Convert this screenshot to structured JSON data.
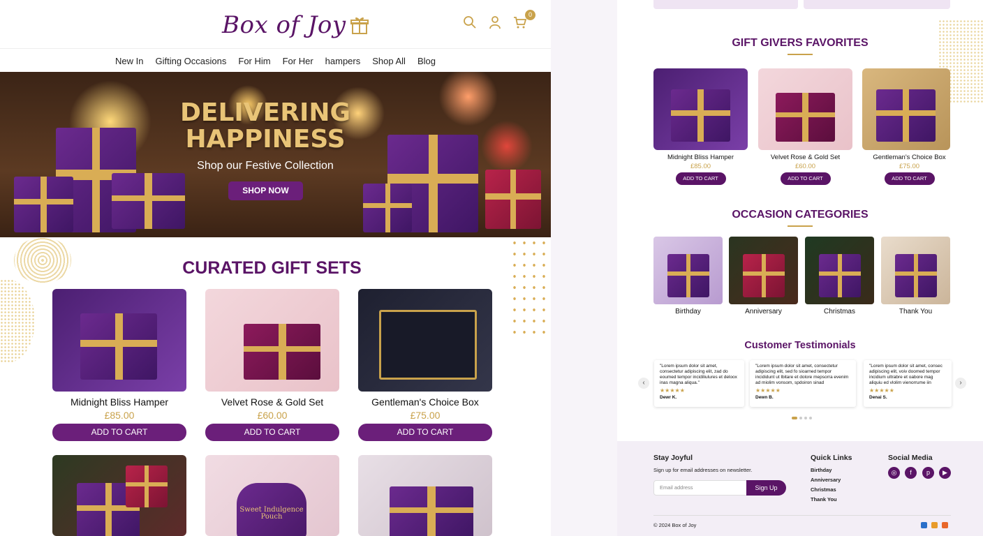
{
  "brand": {
    "logo_text": "Box of Joy",
    "primary": "#5a1466",
    "accent": "#c9a24b"
  },
  "header": {
    "icons": [
      "search-icon",
      "user-icon",
      "cart-icon"
    ],
    "cart_count": "0"
  },
  "nav": [
    "New In",
    "Gifting Occasions",
    "For Him",
    "For Her",
    "hampers",
    "Shop All",
    "Blog"
  ],
  "hero": {
    "title_line1": "DELIVERING",
    "title_line2": "HAPPINESS",
    "subtitle": "Shop our Festive Collection",
    "cta": "SHOP NOW"
  },
  "curated": {
    "title": "CURATED GIFT SETS",
    "items": [
      {
        "name": "Midnight Bliss Hamper",
        "price": "£85.00",
        "cta": "ADD TO CART"
      },
      {
        "name": "Velvet Rose & Gold Set",
        "price": "£60.00",
        "cta": "ADD TO CART"
      },
      {
        "name": "Gentleman's Choice Box",
        "price": "£75.00",
        "cta": "ADD TO CART"
      }
    ],
    "row2_pouch_text": "Sweet Indulgence Pouch"
  },
  "favorites": {
    "title": "GIFT GIVERS FAVORITES",
    "items": [
      {
        "name": "Midnight Bliss Hamper",
        "price": "£85.00",
        "cta": "ADD TO CART"
      },
      {
        "name": "Velvet Rose & Gold Set",
        "price": "£60.00",
        "cta": "ADD TO CART"
      },
      {
        "name": "Gentleman's Choice Box",
        "price": "£75.00",
        "cta": "ADD TO CART"
      }
    ]
  },
  "occasions": {
    "title": "OCCASION CATEGORIES",
    "items": [
      "Birthday",
      "Anniversary",
      "Christmas",
      "Thank You"
    ]
  },
  "testimonials": {
    "title": "Customer Testimonials",
    "items": [
      {
        "text": "\"Lorem ipsum dolor sit amet, consectetur adipiscing elit, zad do eoumed tempor incidiliulures et deloox inas magna aliqua.\"",
        "stars": "★★★★★",
        "author": "Dewr K."
      },
      {
        "text": "\"Lorem ipsum dolor sit amet, consectetur adipiscing elit, sed fo sioarned tempor incididunt ut lbitare et dolore mepsorra evenim ad miolim vonsom, spdoiron sinad",
        "stars": "★★★★★",
        "author": "Dewn B."
      },
      {
        "text": "\"Lorem ipsum dolor sit amet, consec adipiscing elit, voiv doomed tempor incidium ultrabre et oabore mag aliquiu ed vlolim vienorrume iin",
        "stars": "★★★★★",
        "author": "Denai S."
      }
    ],
    "prev_icon": "chevron-left-icon",
    "next_icon": "chevron-right-icon"
  },
  "footer": {
    "newsletter_title": "Stay Joyful",
    "newsletter_text": "Sign up for email addresses on newsletter.",
    "email_placeholder": "Email address",
    "signup_label": "Sign Up",
    "quick_links_title": "Quick Links",
    "quick_links": [
      "Birthday",
      "Anniversary",
      "Christmas",
      "Thank You"
    ],
    "social_title": "Social Media",
    "social_icons": [
      "instagram-icon",
      "facebook-icon",
      "pinterest-icon",
      "youtube-icon"
    ],
    "copyright": "© 2024 Box of Joy"
  }
}
